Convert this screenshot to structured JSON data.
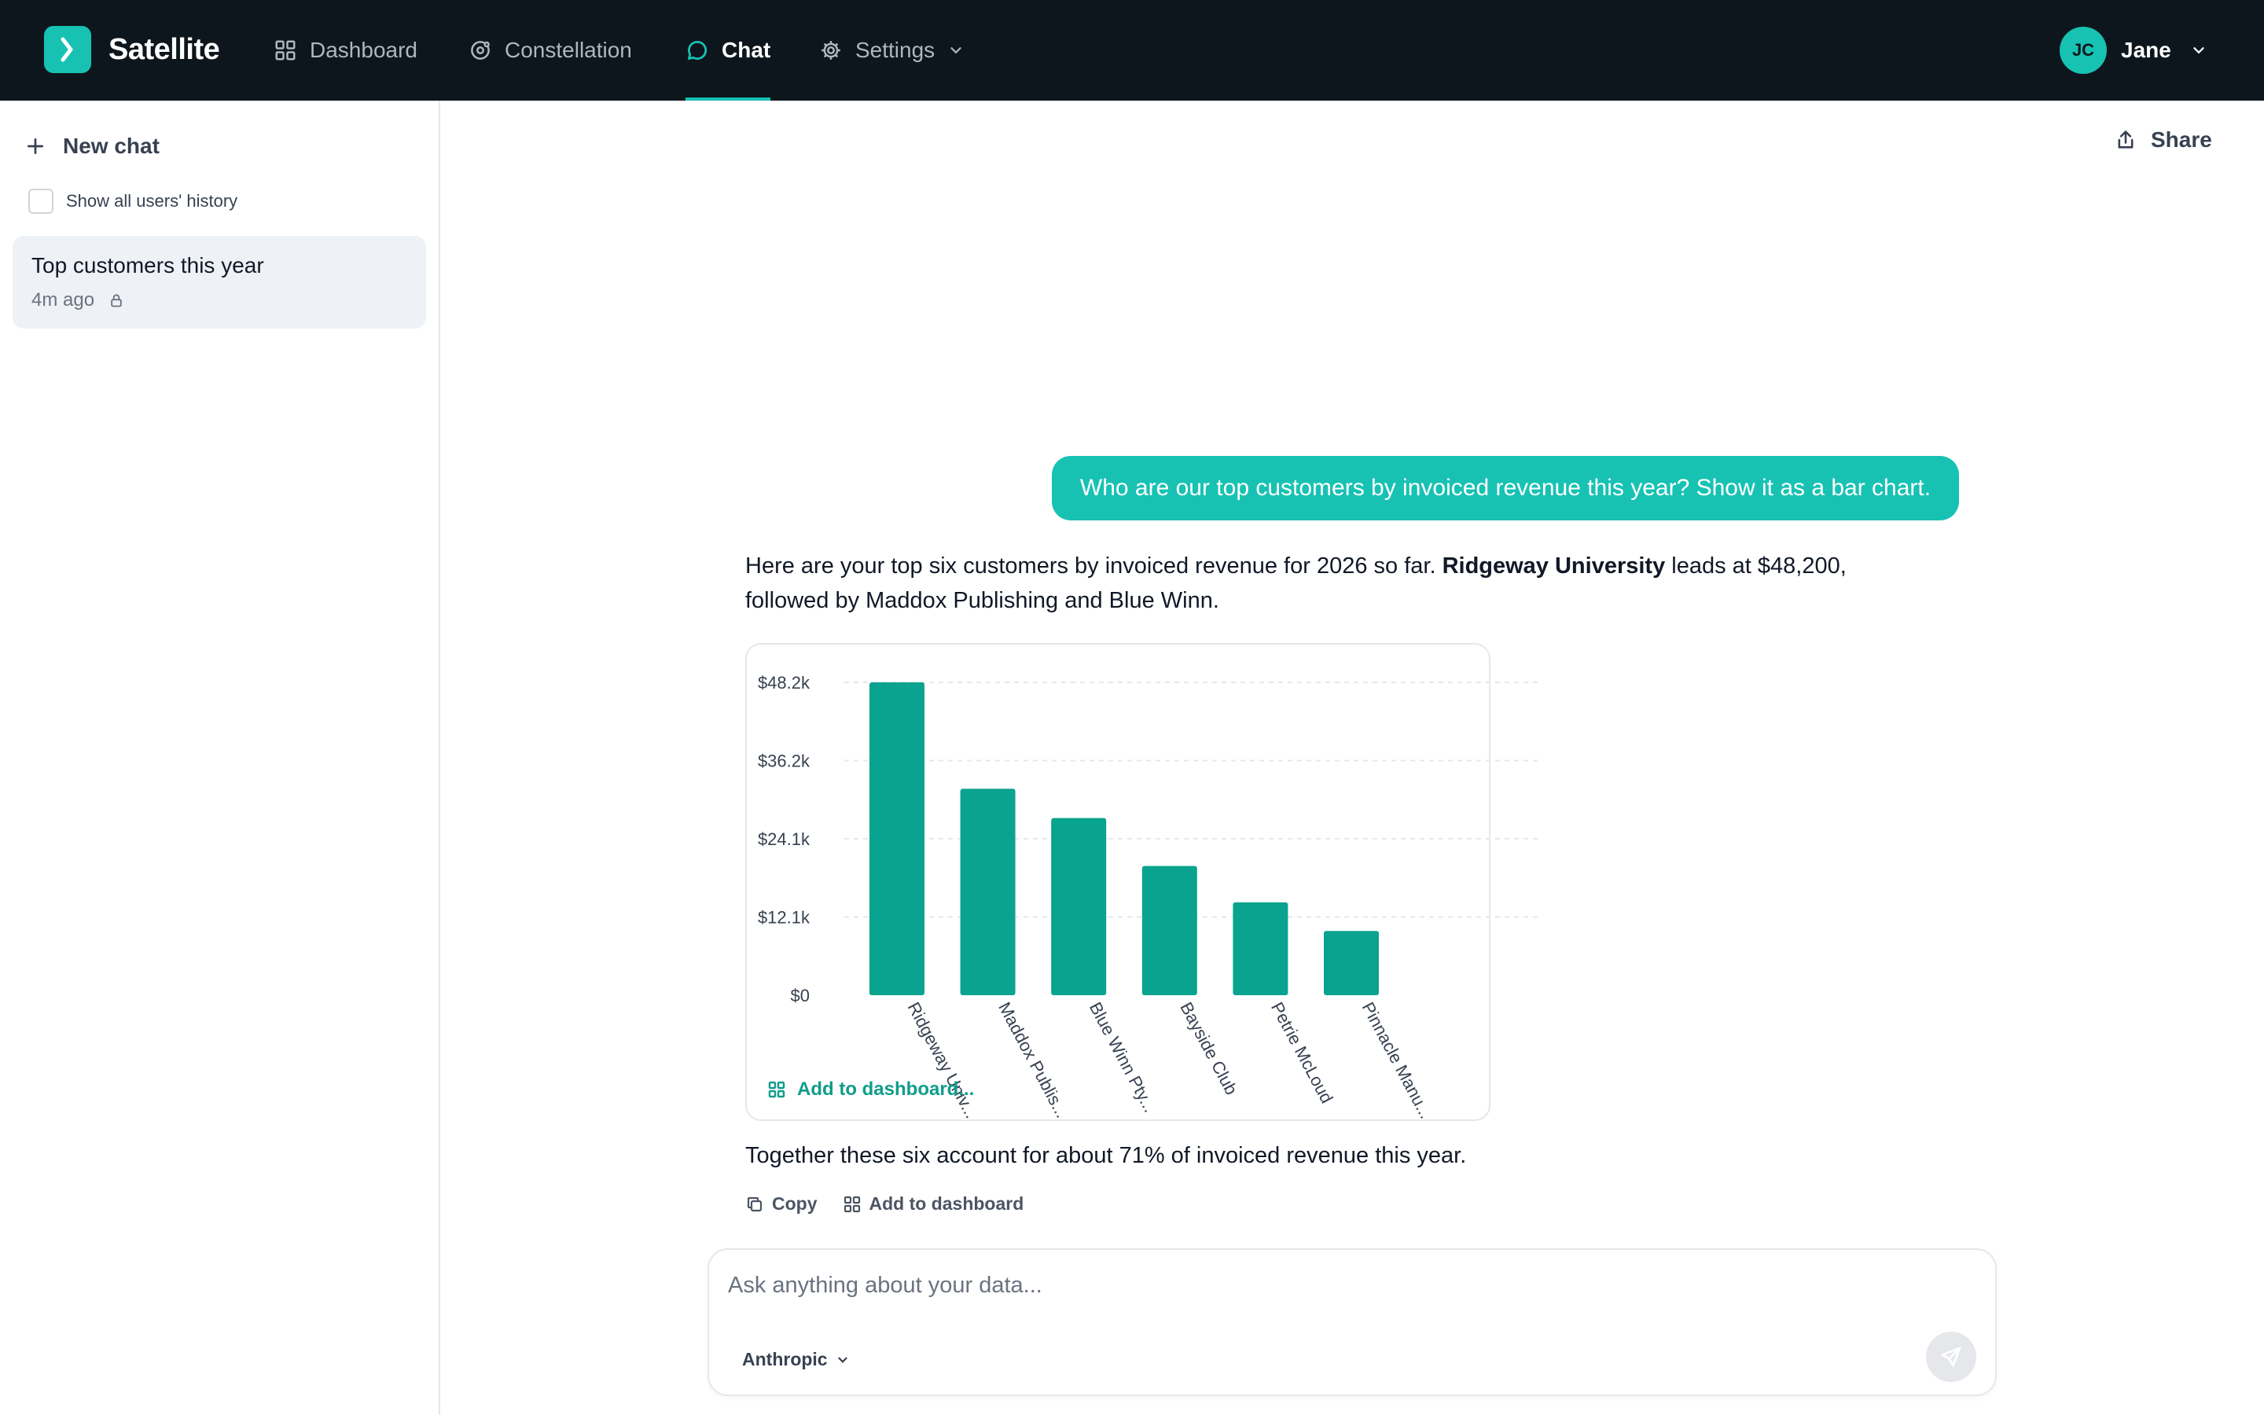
{
  "app": {
    "name": "Satellite"
  },
  "nav": {
    "items": [
      {
        "label": "Dashboard",
        "icon": "grid-icon"
      },
      {
        "label": "Constellation",
        "icon": "orbit-icon"
      },
      {
        "label": "Chat",
        "icon": "chat-bubble-icon",
        "active": true
      },
      {
        "label": "Settings",
        "icon": "gear-icon"
      }
    ]
  },
  "user": {
    "initials": "JC",
    "name": "Jane"
  },
  "sidebar": {
    "new_chat": "New chat",
    "show_history": "Show all users' history",
    "history": [
      {
        "title": "Top customers this year",
        "time": "4m ago"
      }
    ]
  },
  "header": {
    "share": "Share"
  },
  "conversation": {
    "question": "Who are our top customers by invoiced revenue this year? Show it as a bar chart.",
    "answer_pre": "Here are your top six customers by invoiced revenue for 2026 so far. ",
    "answer_bold": "Ridgeway University",
    "answer_post": " leads at $48,200, followed by Maddox Publishing and Blue Winn.",
    "chart_action": "Add to dashboard...",
    "summary": "Together these six account for about 71% of invoiced revenue this year.",
    "actions": {
      "copy": "Copy",
      "add_to_dashboard": "Add to dashboard"
    }
  },
  "composer": {
    "placeholder": "Ask anything about your data...",
    "model": "Anthropic"
  },
  "colors": {
    "accent": "#17c2b3",
    "bar": "#0aa38f",
    "topbar": "#0d161c"
  },
  "chart_data": {
    "type": "bar",
    "categories": [
      "Ridgeway Univ...",
      "Maddox Publis...",
      "Blue Winn Pty...",
      "Bayside Club",
      "Petrie McLoud",
      "Pinnacle Manu..."
    ],
    "values": [
      48200,
      31800,
      27300,
      19900,
      14300,
      9900
    ],
    "y_ticks": [
      "$0",
      "$12.1k",
      "$24.1k",
      "$36.2k",
      "$48.2k"
    ],
    "ylim": [
      0,
      48200
    ],
    "grid": true
  }
}
